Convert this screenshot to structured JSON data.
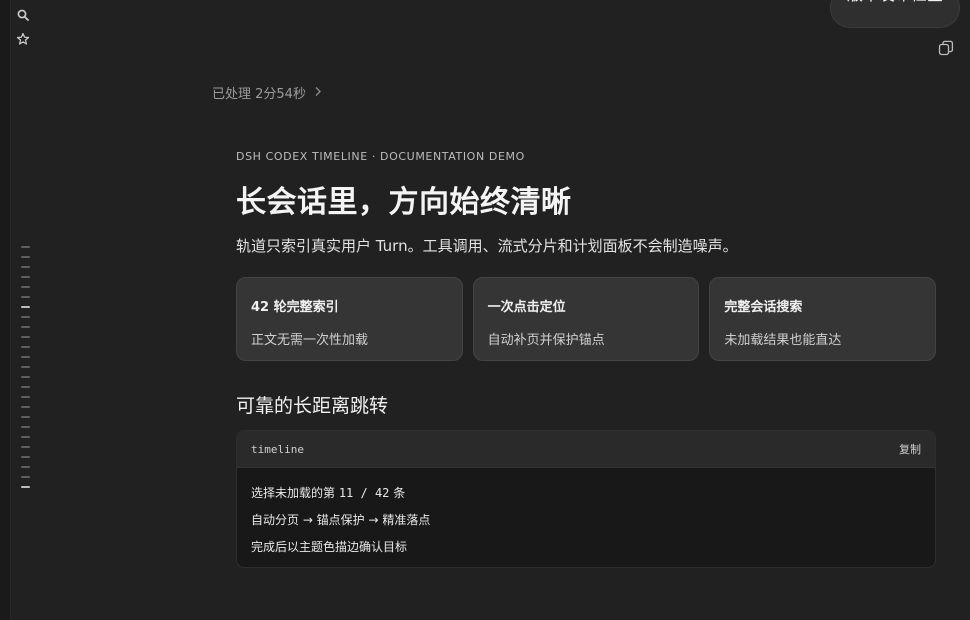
{
  "toolbar": {
    "release_label": "版本发布检查"
  },
  "rail": {
    "icons": [
      "search-icon",
      "star-icon"
    ],
    "ticks": [
      {
        "active": false
      },
      {
        "active": false
      },
      {
        "active": false
      },
      {
        "active": false
      },
      {
        "active": false
      },
      {
        "active": false
      },
      {
        "active": true
      },
      {
        "active": false
      },
      {
        "active": false
      },
      {
        "active": false
      },
      {
        "active": false
      },
      {
        "active": false
      },
      {
        "active": false
      },
      {
        "active": false
      },
      {
        "active": false
      },
      {
        "active": false
      },
      {
        "active": false
      },
      {
        "active": false
      },
      {
        "active": false
      },
      {
        "active": false
      },
      {
        "active": false
      },
      {
        "active": false
      },
      {
        "active": false
      },
      {
        "active": false
      },
      {
        "active": true
      }
    ]
  },
  "status": {
    "processed": "已处理 2分54秒"
  },
  "doc": {
    "eyebrow": "DSH CODEX TIMELINE · DOCUMENTATION DEMO",
    "title": "长会话里，方向始终清晰",
    "lead": "轨道只索引真实用户 Turn。工具调用、流式分片和计划面板不会制造噪声。",
    "cards": [
      {
        "title": "42 轮完整索引",
        "desc": "正文无需一次性加载"
      },
      {
        "title": "一次点击定位",
        "desc": "自动补页并保护锚点"
      },
      {
        "title": "完整会话搜索",
        "desc": "未加载结果也能直达"
      }
    ],
    "section_title": "可靠的长距离跳转",
    "code": {
      "lang": "timeline",
      "copy_label": "复制",
      "line1_prefix": "选择未加载的第 ",
      "line1_value": "11 / 42",
      "line1_suffix": " 条",
      "line2": "自动分页 → 锚点保护 → 精准落点",
      "line3": "完成后以主题色描边确认目标"
    }
  },
  "colors": {
    "background": "#212121",
    "card": "#353535",
    "code_bg": "#181818"
  }
}
